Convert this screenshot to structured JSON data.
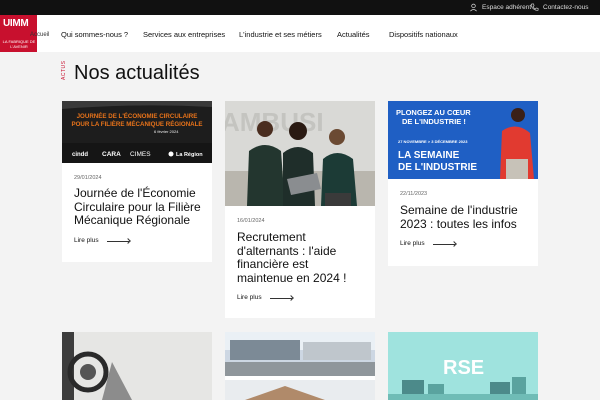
{
  "topbar": {
    "account_label": "Espace adhérent",
    "contact_label": "Contactez-nous",
    "account_icon": "user-icon",
    "contact_icon": "phone-icon"
  },
  "logo": {
    "name": "UIMM",
    "tagline": "LA FABRIQUE DE L'AVENIR",
    "overlay": "Accueil"
  },
  "nav": {
    "items": [
      "Qui sommes-nous ?",
      "Services aux entreprises",
      "L'industrie et ses métiers",
      "Actualités",
      "Dispositifs nationaux"
    ]
  },
  "section": {
    "tag": "ACTUS",
    "title": "Nos actualités"
  },
  "cards": [
    {
      "date": "29/01/2024",
      "title": "Journée de l'Économie Circulaire pour la Filière Mécanique Régionale",
      "more": "Lire plus",
      "image": {
        "line1": "JOURNÉE DE L'ÉCONOMIE CIRCULAIRE",
        "line2": "POUR LA FILIÈRE MÉCANIQUE RÉGIONALE",
        "date": "6 février 2024",
        "logos": [
          "cindd",
          "CARA",
          "CIMES",
          "La Région"
        ]
      }
    },
    {
      "date": "16/01/2024",
      "title": "Recrutement d'alternants : l'aide financière est maintenue en 2024 !",
      "more": "Lire plus",
      "image": {
        "bg_text": "AMBUSI"
      }
    },
    {
      "date": "22/11/2023",
      "title": "Semaine de l'industrie 2023 : toutes les infos",
      "more": "Lire plus",
      "image": {
        "line1": "PLONGEZ AU CŒUR",
        "line2": "DE L'INDUSTRIE !",
        "dates": "27 NOVEMBRE > 3 DÉCEMBRE 2023",
        "banner1": "LA SEMAINE",
        "banner2": "DE L'INDUSTRIE"
      }
    }
  ],
  "bottom_cards": [
    {
      "label": ""
    },
    {
      "label": ""
    },
    {
      "label": "RSE"
    }
  ],
  "colors": {
    "brand_red": "#c8102e",
    "topbar": "#111111",
    "blue": "#1f5fc4",
    "teal": "#9fe3de",
    "orange": "#e8731a"
  }
}
